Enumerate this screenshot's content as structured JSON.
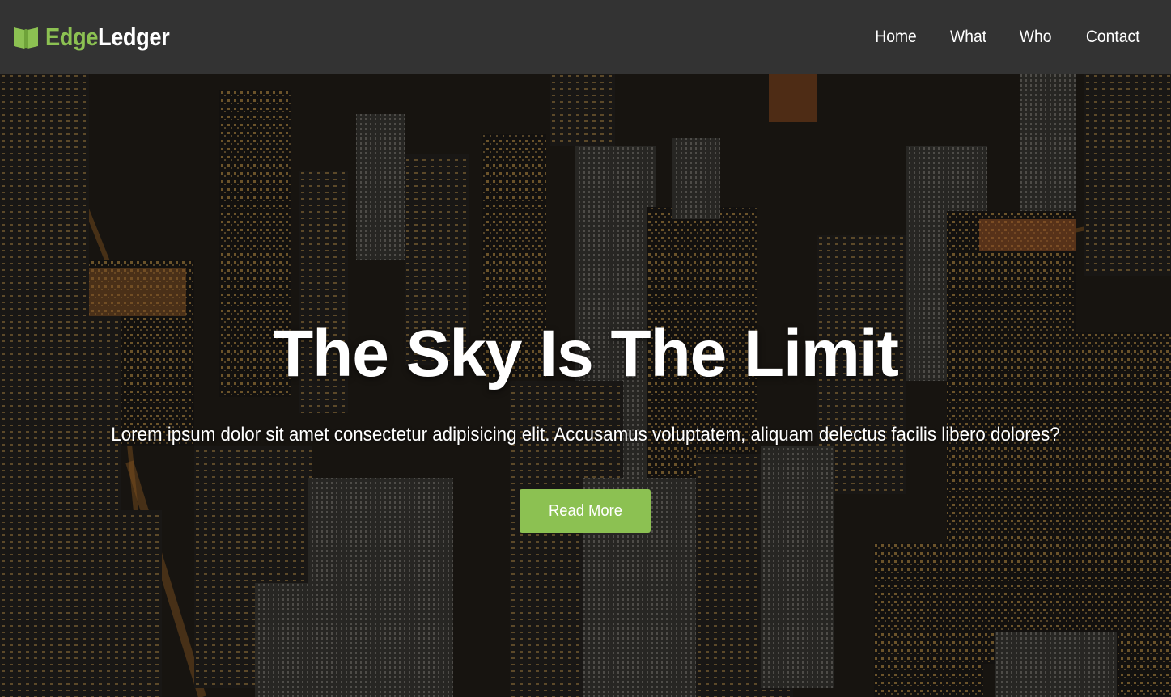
{
  "brand": {
    "part1": "Edge",
    "part2": "Ledger",
    "icon": "open-book-icon",
    "accent_color": "#8cc152"
  },
  "nav": {
    "items": [
      {
        "label": "Home"
      },
      {
        "label": "What"
      },
      {
        "label": "Who"
      },
      {
        "label": "Contact"
      }
    ],
    "background": "#333333"
  },
  "hero": {
    "title": "The Sky Is The Limit",
    "subtitle": "Lorem ipsum dolor sit amet consectetur adipisicing elit. Accusamus voluptatem, aliquam delectus facilis libero dolores?",
    "button_label": "Read More",
    "button_color": "#8cc152",
    "background_image": "night-city-skyline-image"
  }
}
